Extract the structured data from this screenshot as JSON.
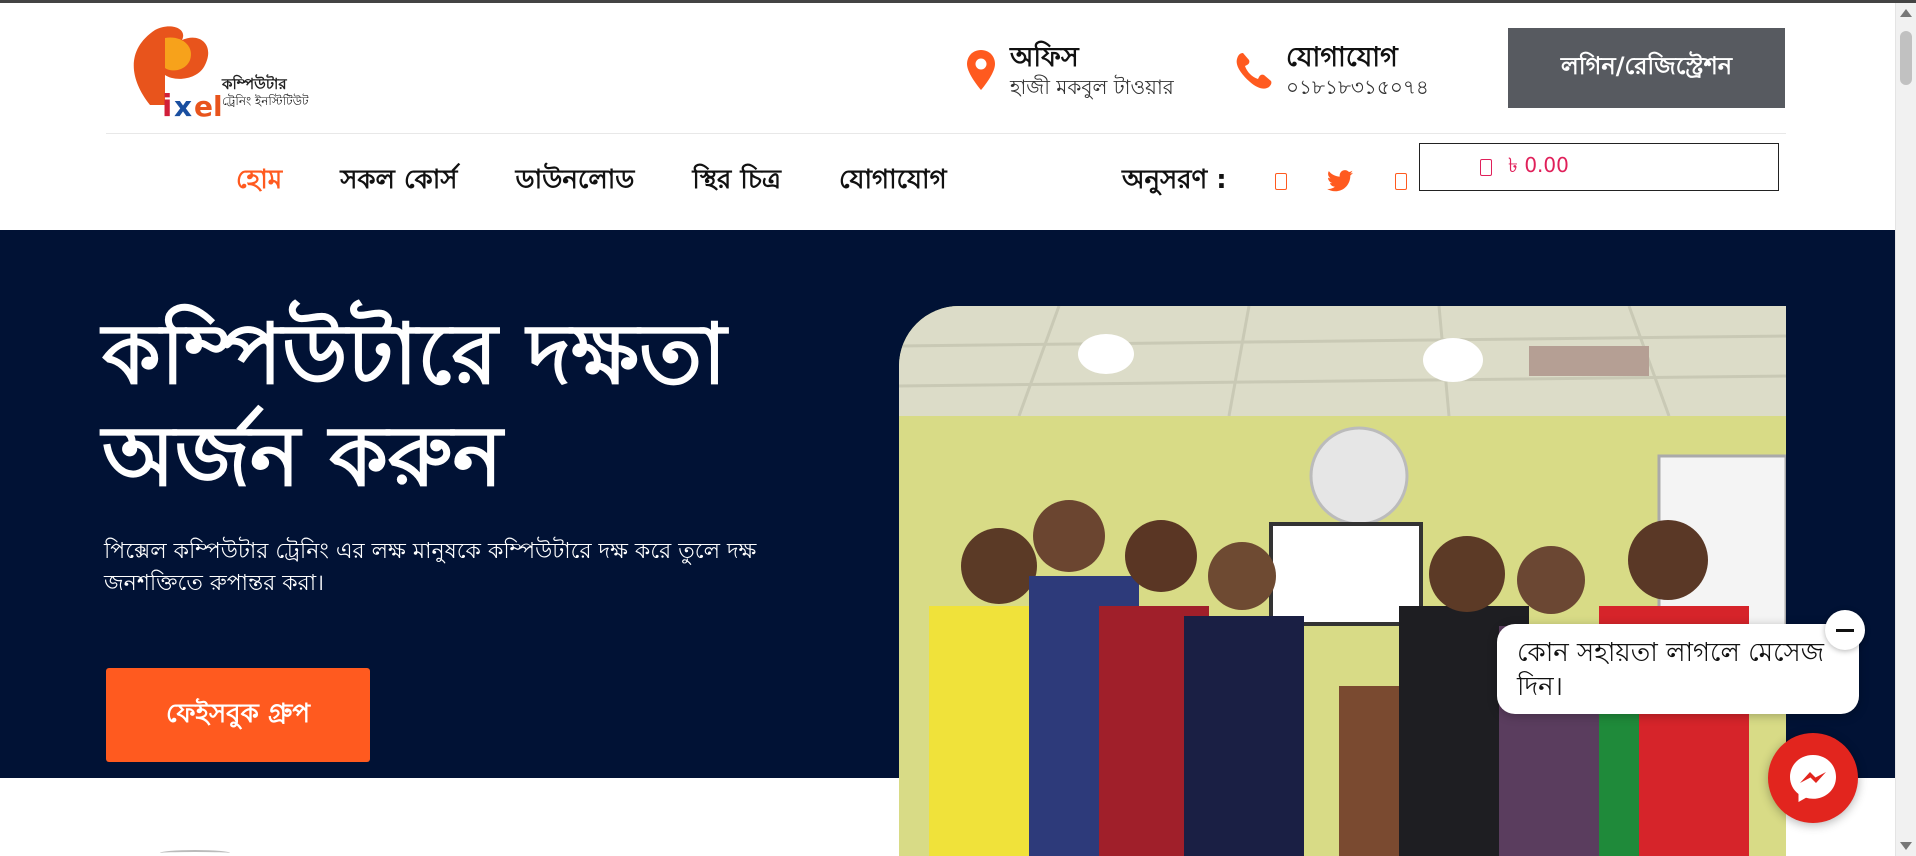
{
  "header": {
    "logo_alt": "Pixel",
    "logo_name": "কম্পিউটার",
    "logo_sub": "ট্রেনিং ইনস্টিটিউট",
    "office": {
      "title": "অফিস",
      "subtitle": "হাজী মকবুল টাওয়ার",
      "icon": "map-pin-icon"
    },
    "contact": {
      "title": "যোগাযোগ",
      "subtitle": "০১৮১৮৩১৫০৭৪",
      "icon": "phone-icon"
    },
    "login_label": "লগিন/রেজিস্ট্রেশন"
  },
  "nav": {
    "items": [
      {
        "label": "হোম",
        "active": true
      },
      {
        "label": "সকল কোর্স",
        "active": false
      },
      {
        "label": "ডাউনলোড",
        "active": false
      },
      {
        "label": "স্থির চিত্র",
        "active": false
      },
      {
        "label": "যোগাযোগ",
        "active": false
      }
    ],
    "follow_label": "অনুসরণ :",
    "social": [
      "facebook-icon",
      "twitter-icon",
      "youtube-icon"
    ],
    "cart_amount": "৳ 0.00"
  },
  "hero": {
    "title": "কম্পিউটারে দক্ষতা অর্জন করুন",
    "description": "পিক্সেল কম্পিউটার ট্রেনিং এর লক্ষ মানুষকে কম্পিউটারে দক্ষ করে তুলে দক্ষ জনশক্তিতে রুপান্তর করা।",
    "button_label": "ফেইসবুক গ্রুপ"
  },
  "chat": {
    "bubble_text": "কোন সহায়তা লাগলে মেসেজ দিন।",
    "close_icon": "minus-icon",
    "messenger_icon": "messenger-icon"
  },
  "colors": {
    "accent": "#ff5a1f",
    "hero_bg": "#011235",
    "login_bg": "#575a60",
    "cart_text": "#e0205a",
    "messenger": "#e2251e"
  }
}
